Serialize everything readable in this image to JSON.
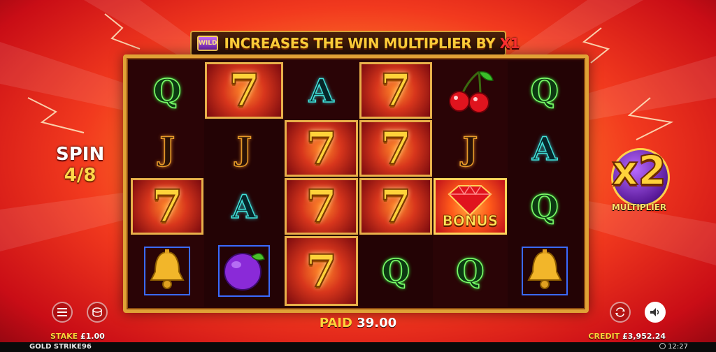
{
  "banner": {
    "wild_badge": "WILD",
    "text": "INCREASES THE WIN MULTIPLIER BY",
    "multiplier": "X1"
  },
  "spin": {
    "label": "SPIN",
    "count": "4/8"
  },
  "multiplier": {
    "value": "x2",
    "label": "MULTIPLIER"
  },
  "reels": [
    [
      "Q",
      "J",
      "7",
      "bell"
    ],
    [
      "7",
      "J",
      "A",
      "plum"
    ],
    [
      "A",
      "7",
      "7",
      "7"
    ],
    [
      "7",
      "7",
      "7",
      "Q"
    ],
    [
      "cherries",
      "J",
      "bonus",
      "Q"
    ],
    [
      "Q",
      "A",
      "Q",
      "bell"
    ]
  ],
  "bonus_label": "BONUS",
  "footer": {
    "paid_label": "PAID",
    "paid_value": "39.00",
    "stake_label": "STAKE",
    "stake_value": "£1.00",
    "credit_label": "CREDIT",
    "credit_value": "£3,952.24",
    "game_name": "GOLD STRIKE96",
    "clock": "12:27"
  },
  "icons": {
    "menu": "hamburger-menu-icon",
    "stake": "coin-stack-icon",
    "autoplay": "autoplay-icon",
    "sound": "speaker-icon"
  },
  "colors": {
    "gold": "#ffd23a",
    "frame": "#e0a236",
    "q_green": "#2aff3a",
    "j_orange": "#e69a2a",
    "a_teal": "#42e0d8"
  }
}
